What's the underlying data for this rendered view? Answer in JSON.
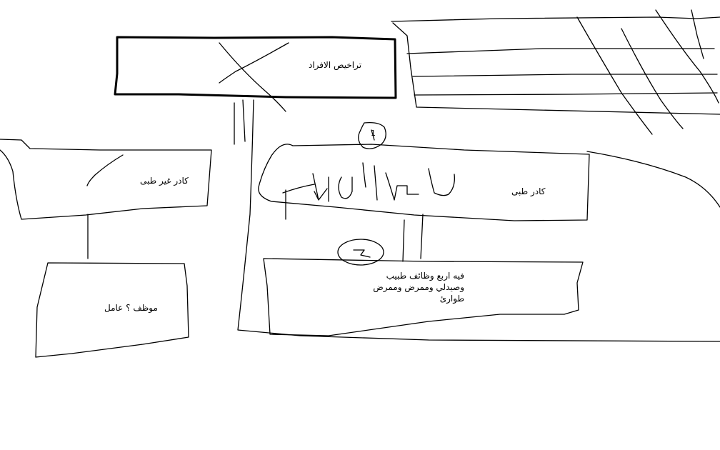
{
  "diagram": {
    "nodes": {
      "individuals_licenses": "تراخيص الافراد",
      "medical_staff": "كادر طبى",
      "non_medical_staff": "كادر غير طبى",
      "employee_worker": "موظف ؟ عامل",
      "medical_roles": [
        "فيه اربع وظائف طبيب",
        "وصيدلي وممرض وممرض",
        "طوارئ"
      ]
    },
    "markers": {
      "marker_one": "1",
      "marker_two": "2"
    },
    "stroke_color": "#000000",
    "background_color": "#ffffff"
  }
}
